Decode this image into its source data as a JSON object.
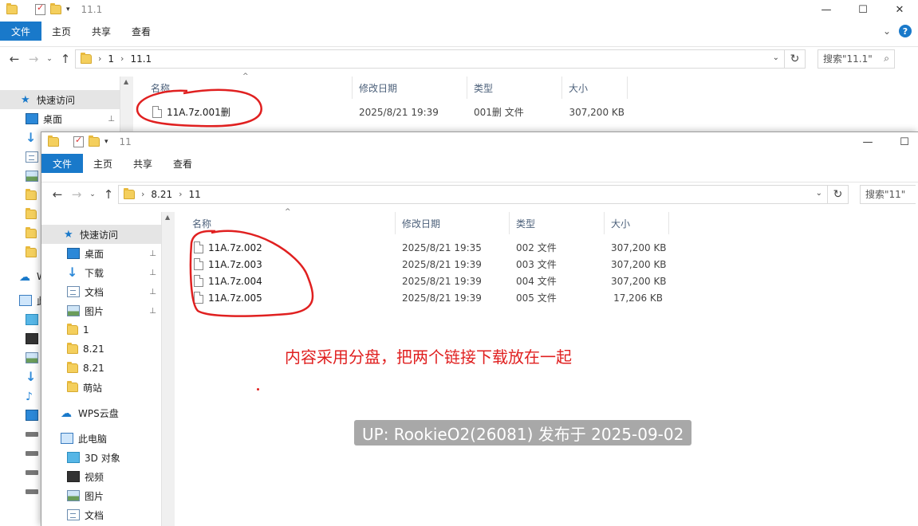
{
  "back_window": {
    "title": "11.1",
    "ribbon_tabs": [
      "文件",
      "主页",
      "共享",
      "查看"
    ],
    "breadcrumb": [
      "1",
      "11.1"
    ],
    "search_placeholder": "搜索\"11.1\"",
    "quick_access_label": "快速访问",
    "desktop_label": "桌面",
    "wps_cut": "W",
    "pc_cut": "此",
    "columns": [
      "名称",
      "修改日期",
      "类型",
      "大小"
    ],
    "files": [
      {
        "name": "11A.7z.001删",
        "date": "2025/8/21 19:39",
        "type": "001删 文件",
        "size": "307,200 KB"
      }
    ]
  },
  "front_window": {
    "title": "11",
    "ribbon_tabs": [
      "文件",
      "主页",
      "共享",
      "查看"
    ],
    "breadcrumb": [
      "8.21",
      "11"
    ],
    "search_placeholder": "搜索\"11\"",
    "nav_items": [
      {
        "label": "快速访问",
        "icon": "star-icon"
      },
      {
        "label": "桌面",
        "icon": "desktop-icon",
        "pinned": true
      },
      {
        "label": "下载",
        "icon": "download-icon",
        "pinned": true
      },
      {
        "label": "文档",
        "icon": "document-icon",
        "pinned": true
      },
      {
        "label": "图片",
        "icon": "picture-icon",
        "pinned": true
      },
      {
        "label": "1",
        "icon": "folder-icon"
      },
      {
        "label": "8.21",
        "icon": "folder-icon"
      },
      {
        "label": "8.21",
        "icon": "folder-icon"
      },
      {
        "label": "萌站",
        "icon": "folder-icon"
      },
      {
        "label": "WPS云盘",
        "icon": "cloud-icon"
      },
      {
        "label": "此电脑",
        "icon": "computer-icon"
      },
      {
        "label": "3D 对象",
        "icon": "3d-objects-icon"
      },
      {
        "label": "视频",
        "icon": "video-icon"
      },
      {
        "label": "图片",
        "icon": "picture-icon"
      },
      {
        "label": "文档",
        "icon": "document-icon"
      }
    ],
    "columns": [
      "名称",
      "修改日期",
      "类型",
      "大小"
    ],
    "files": [
      {
        "name": "11A.7z.002",
        "date": "2025/8/21 19:35",
        "type": "002 文件",
        "size": "307,200 KB"
      },
      {
        "name": "11A.7z.003",
        "date": "2025/8/21 19:39",
        "type": "003 文件",
        "size": "307,200 KB"
      },
      {
        "name": "11A.7z.004",
        "date": "2025/8/21 19:39",
        "type": "004 文件",
        "size": "307,200 KB"
      },
      {
        "name": "11A.7z.005",
        "date": "2025/8/21 19:39",
        "type": "005 文件",
        "size": "17,206 KB"
      }
    ]
  },
  "annotation_text": "内容采用分盘，把两个链接下载放在一起",
  "watermark": "UP: RookieO2(26081) 发布于 2025-09-02",
  "colors": {
    "file_tab": "#1979ca",
    "annotation_red": "#e02020",
    "selection_gray": "#e5e5e5"
  }
}
